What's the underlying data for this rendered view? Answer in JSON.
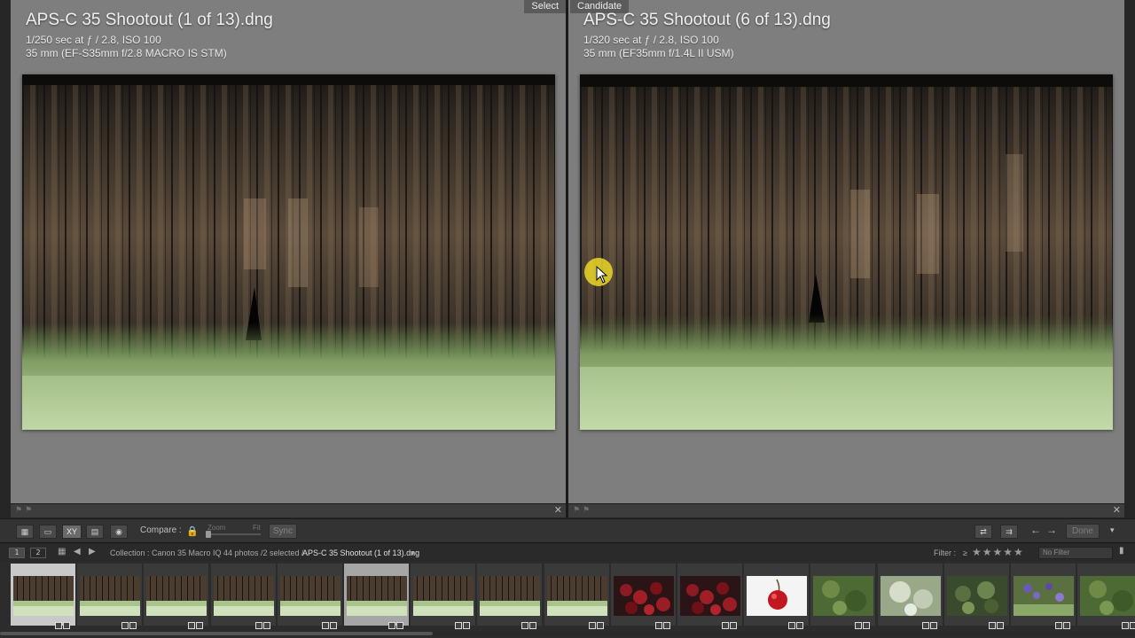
{
  "left_pane": {
    "badge": "Select",
    "title": "APS-C 35 Shootout (1 of 13).dng",
    "exposure": "1/250 sec at ƒ / 2.8, ISO 100",
    "lens": "35 mm (EF-S35mm f/2.8 MACRO IS STM)"
  },
  "right_pane": {
    "badge": "Candidate",
    "title": "APS-C 35 Shootout (6 of 13).dng",
    "exposure": "1/320 sec at ƒ / 2.8, ISO 100",
    "lens": "35 mm (EF35mm f/1.4L II USM)"
  },
  "toolbar": {
    "compare_label": "Compare :",
    "zoom_label": "Zoom",
    "fit_label": "Fit",
    "sync_label": "Sync",
    "done_label": "Done",
    "view_icons": [
      "grid-view-icon",
      "loupe-view-icon",
      "compare-view-icon",
      "survey-view-icon",
      "people-view-icon"
    ]
  },
  "filmstrip_header": {
    "tab1": "1",
    "tab2": "2",
    "collection": "Collection : Canon 35 Macro IQ",
    "count": "44 photos /2 selected /",
    "current_file": "APS-C 35 Shootout (1 of 13).dng",
    "filter_label": "Filter :",
    "filter_op": "≥",
    "stars": "★★★★★",
    "filter_value": "No Filter"
  },
  "filmstrip": {
    "thumbs": [
      {
        "kind": "barn",
        "state": "selected"
      },
      {
        "kind": "barn",
        "state": "none"
      },
      {
        "kind": "barn",
        "state": "none"
      },
      {
        "kind": "barn",
        "state": "none"
      },
      {
        "kind": "barn",
        "state": "none"
      },
      {
        "kind": "barn",
        "state": "candidate"
      },
      {
        "kind": "barn",
        "state": "none"
      },
      {
        "kind": "barn",
        "state": "none"
      },
      {
        "kind": "barn",
        "state": "none"
      },
      {
        "kind": "cherries",
        "state": "none"
      },
      {
        "kind": "cherries",
        "state": "none"
      },
      {
        "kind": "cherry-white",
        "state": "none"
      },
      {
        "kind": "green",
        "state": "none"
      },
      {
        "kind": "frost",
        "state": "none"
      },
      {
        "kind": "leaves",
        "state": "none"
      },
      {
        "kind": "flowers",
        "state": "none"
      },
      {
        "kind": "green",
        "state": "none"
      }
    ]
  }
}
